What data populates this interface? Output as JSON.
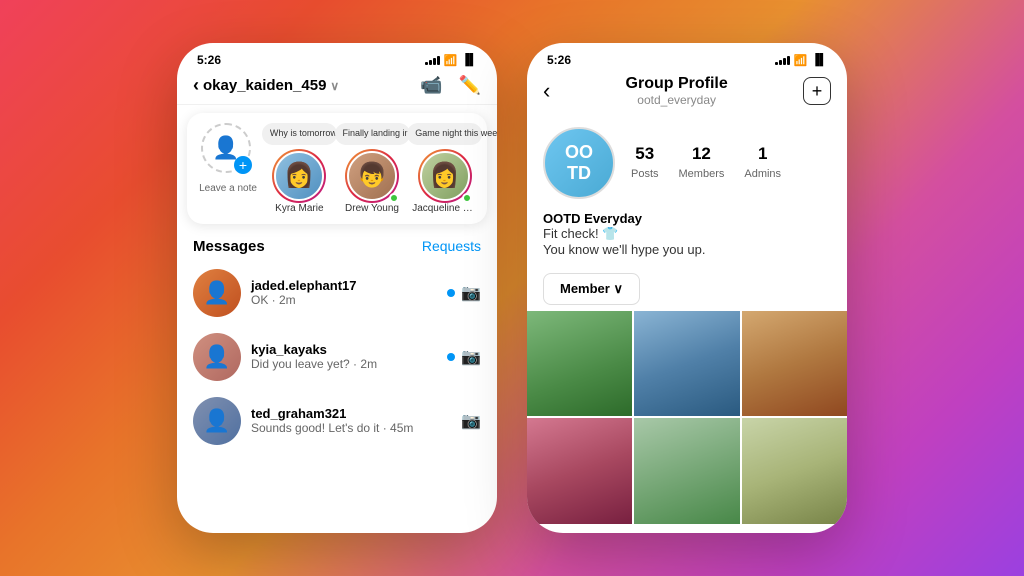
{
  "background": "linear-gradient(135deg, #f0415a, #e84d2f, #e8742a, #e89030, #d44f9f, #c040c0, #9b40e0)",
  "phone_left": {
    "status_bar": {
      "time": "5:26"
    },
    "header": {
      "username": "okay_kaiden_459",
      "chevron": "∨",
      "video_icon": "▭",
      "edit_icon": "✎"
    },
    "stories": [
      {
        "id": "leave-note",
        "label": "Leave a note",
        "type": "note"
      },
      {
        "id": "kyra",
        "label": "Kyra Marie",
        "bubble": "Why is tomorrow Monday!? 😩",
        "type": "story"
      },
      {
        "id": "drew",
        "label": "Drew Young",
        "bubble": "Finally landing in NYC! ❤️",
        "type": "story",
        "online": true
      },
      {
        "id": "jacqueline",
        "label": "Jacqueline Lam",
        "bubble": "Game night this weekend? 🎮",
        "type": "story",
        "online": true
      }
    ],
    "messages_title": "Messages",
    "requests_label": "Requests",
    "messages": [
      {
        "username": "jaded.elephant17",
        "preview": "OK · 2m",
        "unread": true,
        "avatar_color": "#d06030"
      },
      {
        "username": "kyia_kayaks",
        "preview": "Did you leave yet? · 2m",
        "unread": true,
        "avatar_color": "#c09080"
      },
      {
        "username": "ted_graham321",
        "preview": "Sounds good! Let's do it · 45m",
        "unread": false,
        "avatar_color": "#80a0c0"
      }
    ]
  },
  "phone_right": {
    "status_bar": {
      "time": "5:26"
    },
    "header": {
      "back_arrow": "‹",
      "title": "Group Profile",
      "subtitle": "ootd_everyday",
      "add_icon": "+"
    },
    "group": {
      "avatar_line1": "OO",
      "avatar_line2": "TD",
      "stats": [
        {
          "number": "53",
          "label": "Posts"
        },
        {
          "number": "12",
          "label": "Members"
        },
        {
          "number": "1",
          "label": "Admins"
        }
      ],
      "name": "OOTD Everyday",
      "bio_line1": "Fit check! 👕",
      "bio_line2": "You know we'll hype you up.",
      "member_button": "Member ∨"
    }
  }
}
